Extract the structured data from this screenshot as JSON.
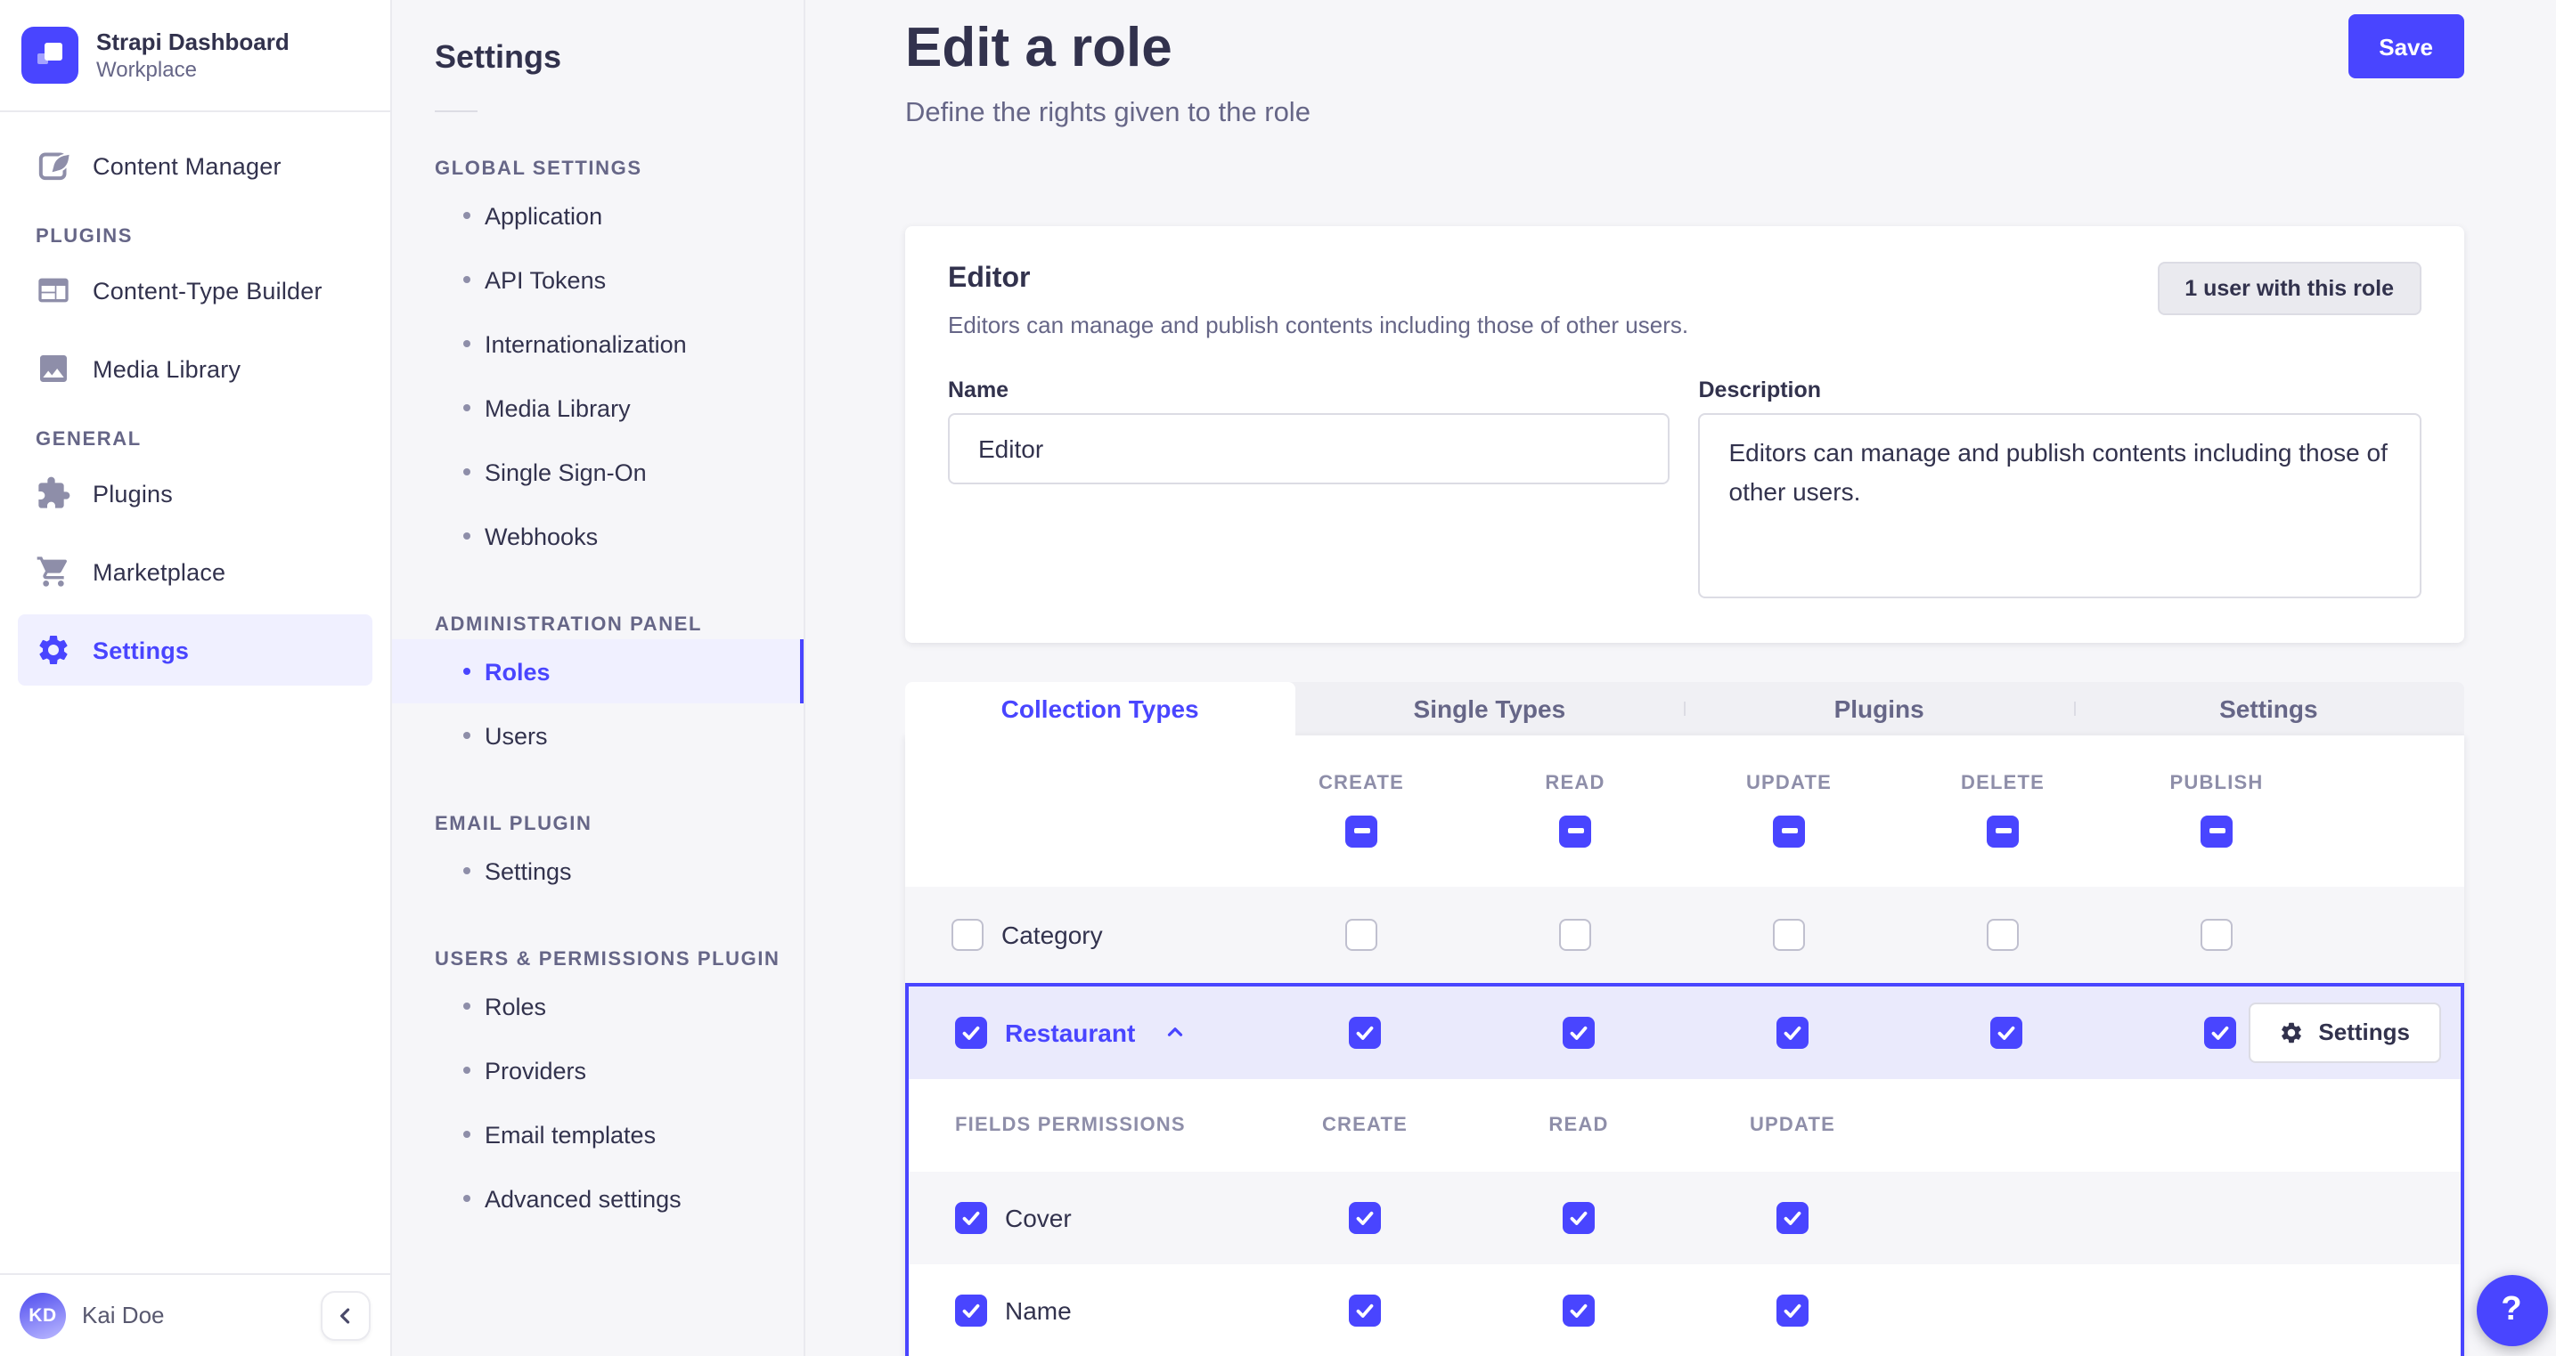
{
  "brand": {
    "title": "Strapi Dashboard",
    "subtitle": "Workplace"
  },
  "main_nav": {
    "content_manager": "Content Manager",
    "sections": [
      {
        "header": "PLUGINS",
        "items": [
          "Content-Type Builder",
          "Media Library"
        ]
      },
      {
        "header": "GENERAL",
        "items": [
          "Plugins",
          "Marketplace",
          "Settings"
        ]
      }
    ],
    "active_item": "Settings",
    "user": {
      "initials": "KD",
      "name": "Kai Doe"
    }
  },
  "subnav": {
    "title": "Settings",
    "sections": [
      {
        "header": "GLOBAL SETTINGS",
        "items": [
          "Application",
          "API Tokens",
          "Internationalization",
          "Media Library",
          "Single Sign-On",
          "Webhooks"
        ]
      },
      {
        "header": "ADMINISTRATION PANEL",
        "items": [
          "Roles",
          "Users"
        ]
      },
      {
        "header": "EMAIL PLUGIN",
        "items": [
          "Settings"
        ]
      },
      {
        "header": "USERS & PERMISSIONS PLUGIN",
        "items": [
          "Roles",
          "Providers",
          "Email templates",
          "Advanced settings"
        ]
      }
    ],
    "active_item": "Roles"
  },
  "page": {
    "title": "Edit a role",
    "subtitle": "Define the rights given to the role",
    "save_label": "Save"
  },
  "role": {
    "title": "Editor",
    "summary": "Editors can manage and publish contents including those of other users.",
    "users_badge": "1 user with this role",
    "name_label": "Name",
    "name": "Editor",
    "description_label": "Description",
    "description": "Editors can manage and publish contents including those of other users."
  },
  "tabs": [
    {
      "label": "Collection Types",
      "active": true
    },
    {
      "label": "Single Types",
      "active": false
    },
    {
      "label": "Plugins",
      "active": false
    },
    {
      "label": "Settings",
      "active": false
    }
  ],
  "permissions": {
    "columns": [
      "CREATE",
      "READ",
      "UPDATE",
      "DELETE",
      "PUBLISH"
    ],
    "header_checkbox_state": "indeterminate",
    "rows": [
      {
        "label": "Category",
        "checked": false,
        "expanded": false
      },
      {
        "label": "Restaurant",
        "checked": true,
        "expanded": true,
        "settings_label": "Settings"
      }
    ],
    "fields": {
      "header": "FIELDS PERMISSIONS",
      "columns": [
        "CREATE",
        "READ",
        "UPDATE"
      ],
      "rows": [
        {
          "label": "Cover",
          "checked": true
        },
        {
          "label": "Name",
          "checked": true
        }
      ]
    }
  },
  "help": {
    "label": "?"
  },
  "colors": {
    "primary": "#4945ff",
    "primary_light": "#f0f0ff",
    "selected_row": "#eaeafc",
    "background": "#f6f6f9"
  }
}
